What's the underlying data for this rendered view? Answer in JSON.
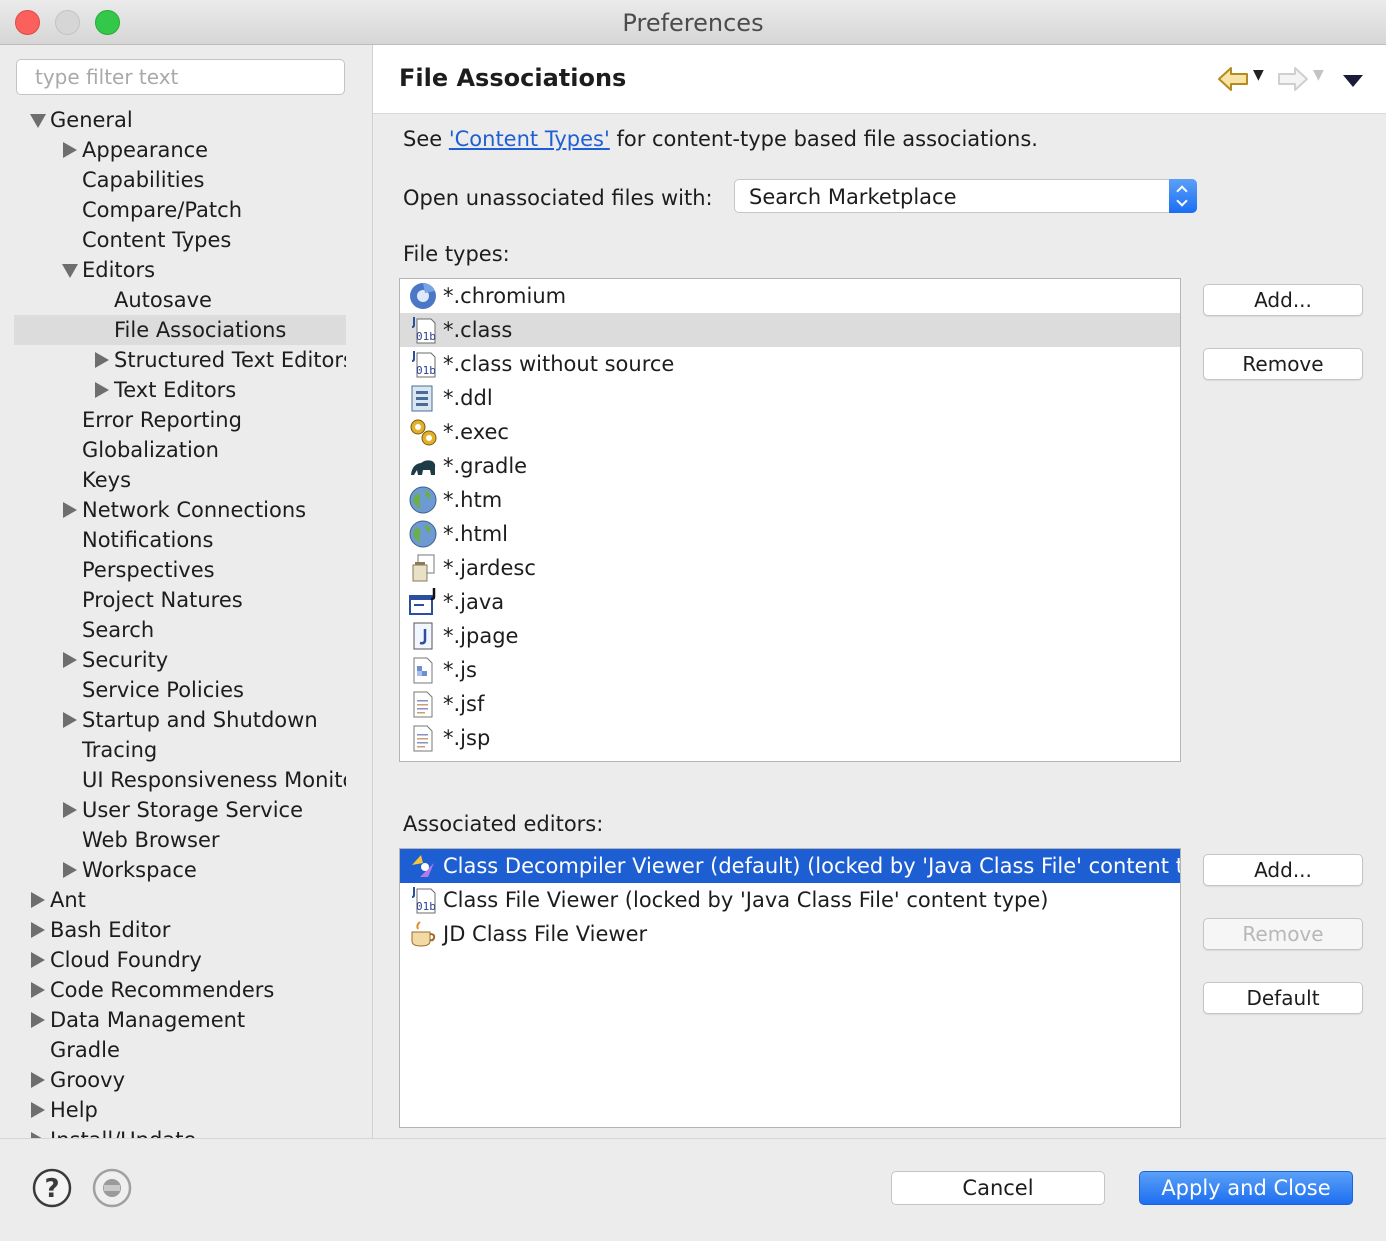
{
  "window": {
    "title": "Preferences"
  },
  "filter": {
    "placeholder": "type filter text"
  },
  "tree": [
    {
      "label": "General",
      "level": 0,
      "toggle": "down"
    },
    {
      "label": "Appearance",
      "level": 1,
      "toggle": "right"
    },
    {
      "label": "Capabilities",
      "level": 1,
      "toggle": "none"
    },
    {
      "label": "Compare/Patch",
      "level": 1,
      "toggle": "none"
    },
    {
      "label": "Content Types",
      "level": 1,
      "toggle": "none"
    },
    {
      "label": "Editors",
      "level": 1,
      "toggle": "down"
    },
    {
      "label": "Autosave",
      "level": 2,
      "toggle": "none"
    },
    {
      "label": "File Associations",
      "level": 2,
      "toggle": "none",
      "selected": true
    },
    {
      "label": "Structured Text Editors",
      "level": 2,
      "toggle": "right"
    },
    {
      "label": "Text Editors",
      "level": 2,
      "toggle": "right"
    },
    {
      "label": "Error Reporting",
      "level": 1,
      "toggle": "none"
    },
    {
      "label": "Globalization",
      "level": 1,
      "toggle": "none"
    },
    {
      "label": "Keys",
      "level": 1,
      "toggle": "none"
    },
    {
      "label": "Network Connections",
      "level": 1,
      "toggle": "right"
    },
    {
      "label": "Notifications",
      "level": 1,
      "toggle": "none"
    },
    {
      "label": "Perspectives",
      "level": 1,
      "toggle": "none"
    },
    {
      "label": "Project Natures",
      "level": 1,
      "toggle": "none"
    },
    {
      "label": "Search",
      "level": 1,
      "toggle": "none"
    },
    {
      "label": "Security",
      "level": 1,
      "toggle": "right"
    },
    {
      "label": "Service Policies",
      "level": 1,
      "toggle": "none"
    },
    {
      "label": "Startup and Shutdown",
      "level": 1,
      "toggle": "right"
    },
    {
      "label": "Tracing",
      "level": 1,
      "toggle": "none"
    },
    {
      "label": "UI Responsiveness Monitoring",
      "level": 1,
      "toggle": "none"
    },
    {
      "label": "User Storage Service",
      "level": 1,
      "toggle": "right"
    },
    {
      "label": "Web Browser",
      "level": 1,
      "toggle": "none"
    },
    {
      "label": "Workspace",
      "level": 1,
      "toggle": "right"
    },
    {
      "label": "Ant",
      "level": 0,
      "toggle": "right"
    },
    {
      "label": "Bash Editor",
      "level": 0,
      "toggle": "right"
    },
    {
      "label": "Cloud Foundry",
      "level": 0,
      "toggle": "right"
    },
    {
      "label": "Code Recommenders",
      "level": 0,
      "toggle": "right"
    },
    {
      "label": "Data Management",
      "level": 0,
      "toggle": "right"
    },
    {
      "label": "Gradle",
      "level": 0,
      "toggle": "none"
    },
    {
      "label": "Groovy",
      "level": 0,
      "toggle": "right"
    },
    {
      "label": "Help",
      "level": 0,
      "toggle": "right"
    },
    {
      "label": "Install/Update",
      "level": 0,
      "toggle": "right"
    }
  ],
  "page": {
    "title": "File Associations",
    "see_prefix": "See ",
    "see_link": "'Content Types'",
    "see_suffix": " for content-type based file associations.",
    "open_label": "Open unassociated files with:",
    "open_value": "Search Marketplace",
    "file_types_label": "File types:",
    "assoc_label": "Associated editors:"
  },
  "file_types": [
    {
      "label": "*.chromium",
      "icon": "chromium-icon"
    },
    {
      "label": "*.class",
      "icon": "class-file-icon",
      "selected": true
    },
    {
      "label": "*.class without source",
      "icon": "class-file-icon"
    },
    {
      "label": "*.ddl",
      "icon": "ddl-icon"
    },
    {
      "label": "*.exec",
      "icon": "gears-icon"
    },
    {
      "label": "*.gradle",
      "icon": "gradle-elephant-icon"
    },
    {
      "label": "*.htm",
      "icon": "globe-icon"
    },
    {
      "label": "*.html",
      "icon": "globe-icon"
    },
    {
      "label": "*.jardesc",
      "icon": "jar-icon"
    },
    {
      "label": "*.java",
      "icon": "java-file-icon"
    },
    {
      "label": "*.jpage",
      "icon": "jpage-icon"
    },
    {
      "label": "*.js",
      "icon": "js-file-icon"
    },
    {
      "label": "*.jsf",
      "icon": "text-file-icon"
    },
    {
      "label": "*.jsp",
      "icon": "text-file-icon"
    }
  ],
  "editors": [
    {
      "label": "Class Decompiler Viewer (default) (locked by 'Java Class File' content type)",
      "icon": "decompiler-icon",
      "selected": true
    },
    {
      "label": "Class File Viewer (locked by 'Java Class File' content type)",
      "icon": "class-file-icon"
    },
    {
      "label": "JD Class File Viewer",
      "icon": "coffee-cup-icon"
    }
  ],
  "buttons": {
    "types_add": "Add...",
    "types_remove": "Remove",
    "editors_add": "Add...",
    "editors_remove": "Remove",
    "editors_default": "Default",
    "cancel": "Cancel",
    "apply": "Apply and Close"
  },
  "colors": {
    "selection_blue": "#1d5fd2",
    "link": "#1f5fd6",
    "primary_button": "#1d6ef1"
  }
}
